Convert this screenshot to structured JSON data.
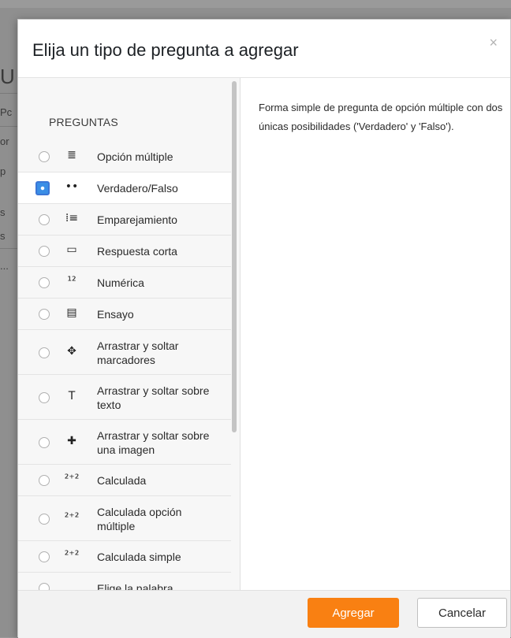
{
  "dialog": {
    "title": "Elija un tipo de pregunta a agregar",
    "close_label": "×",
    "section_label": "PREGUNTAS",
    "description": "Forma simple de pregunta de opción múltiple con dos únicas posibilidades ('Verdadero' y 'Falso').",
    "options": [
      {
        "label": "Opción múltiple",
        "icon": "≣",
        "icon_name": "list-icon",
        "selected": false
      },
      {
        "label": "Verdadero/Falso",
        "icon": "••",
        "icon_name": "dots-icon",
        "selected": true
      },
      {
        "label": "Emparejamiento",
        "icon": "⁞≡",
        "icon_name": "match-icon",
        "selected": false
      },
      {
        "label": "Respuesta corta",
        "icon": "▭",
        "icon_name": "textbox-icon",
        "selected": false
      },
      {
        "label": "Numérica",
        "icon": "¹²",
        "icon_name": "numeric-icon",
        "selected": false
      },
      {
        "label": "Ensayo",
        "icon": "▤",
        "icon_name": "essay-icon",
        "selected": false
      },
      {
        "label": "Arrastrar y soltar marcadores",
        "icon": "✥",
        "icon_name": "drag-markers-icon",
        "selected": false
      },
      {
        "label": "Arrastrar y soltar sobre texto",
        "icon": "T",
        "icon_name": "drag-text-icon",
        "selected": false
      },
      {
        "label": "Arrastrar y soltar sobre una imagen",
        "icon": "✚",
        "icon_name": "drag-image-icon",
        "selected": false
      },
      {
        "label": "Calculada",
        "icon": "²⁺²",
        "icon_name": "calculated-icon",
        "selected": false
      },
      {
        "label": "Calculada opción múltiple",
        "icon": "²⁺²",
        "icon_name": "calculated-multi-icon",
        "selected": false
      },
      {
        "label": "Calculada simple",
        "icon": "²⁺²",
        "icon_name": "calculated-simple-icon",
        "selected": false
      },
      {
        "label": "Elige la palabra",
        "icon": "",
        "icon_name": "choose-word-icon",
        "selected": false
      }
    ]
  },
  "footer": {
    "add_label": "Agregar",
    "cancel_label": "Cancelar"
  },
  "background": {
    "fragments": [
      "U",
      "Pc",
      "or",
      "p",
      "s",
      "s",
      "..."
    ]
  },
  "colors": {
    "primary": "#f98012",
    "selected_radio": "#3a8ee6"
  }
}
